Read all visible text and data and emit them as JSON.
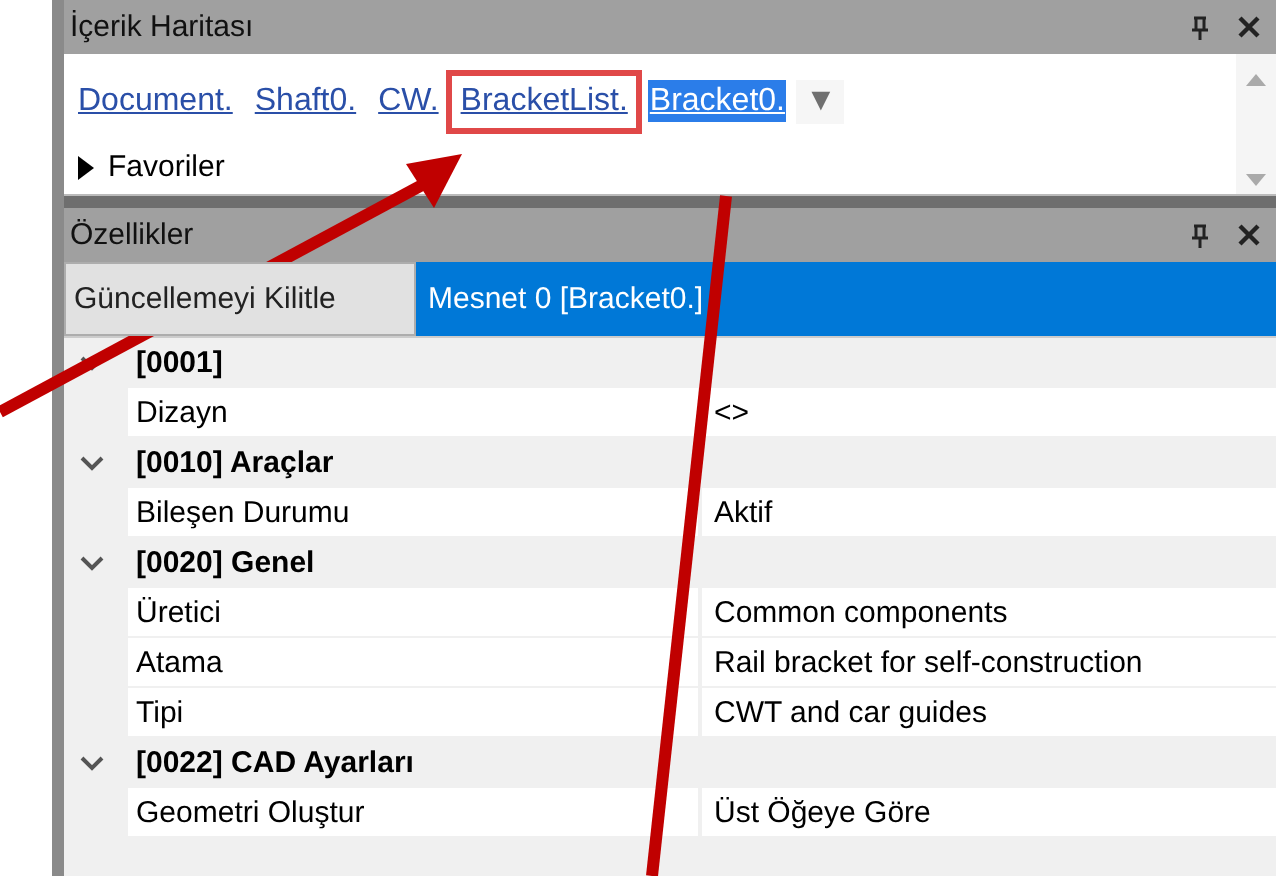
{
  "map_panel": {
    "title": "İçerik Haritası",
    "breadcrumbs": [
      {
        "label": "Document.",
        "selected": false,
        "highlighted": false
      },
      {
        "label": "Shaft0.",
        "selected": false,
        "highlighted": false
      },
      {
        "label": "CW.",
        "selected": false,
        "highlighted": false
      },
      {
        "label": "BracketList.",
        "selected": false,
        "highlighted": true
      },
      {
        "label": "Bracket0.",
        "selected": true,
        "highlighted": false
      }
    ],
    "dropdown": "▼",
    "favorites": {
      "label": "Favoriler",
      "expanded": false
    }
  },
  "properties_panel": {
    "title": "Özellikler",
    "lock_button": "Güncellemeyi Kilitle",
    "object": "Mesnet 0 [Bracket0.]",
    "categories": [
      {
        "title": "[0001]",
        "expanded": true,
        "rows": [
          {
            "name": "Dizayn",
            "value": "<>"
          }
        ]
      },
      {
        "title": "[0010] Araçlar",
        "expanded": true,
        "rows": [
          {
            "name": "Bileşen Durumu",
            "value": "Aktif"
          }
        ]
      },
      {
        "title": "[0020] Genel",
        "expanded": true,
        "rows": [
          {
            "name": "Üretici",
            "value": "Common components"
          },
          {
            "name": "Atama",
            "value": "Rail bracket for self-construction"
          },
          {
            "name": "Tipi",
            "value": "CWT and car guides"
          }
        ]
      },
      {
        "title": "[0022] CAD Ayarları",
        "expanded": true,
        "rows": [
          {
            "name": "Geometri Oluştur",
            "value": "Üst Öğeye Göre"
          }
        ]
      }
    ]
  }
}
